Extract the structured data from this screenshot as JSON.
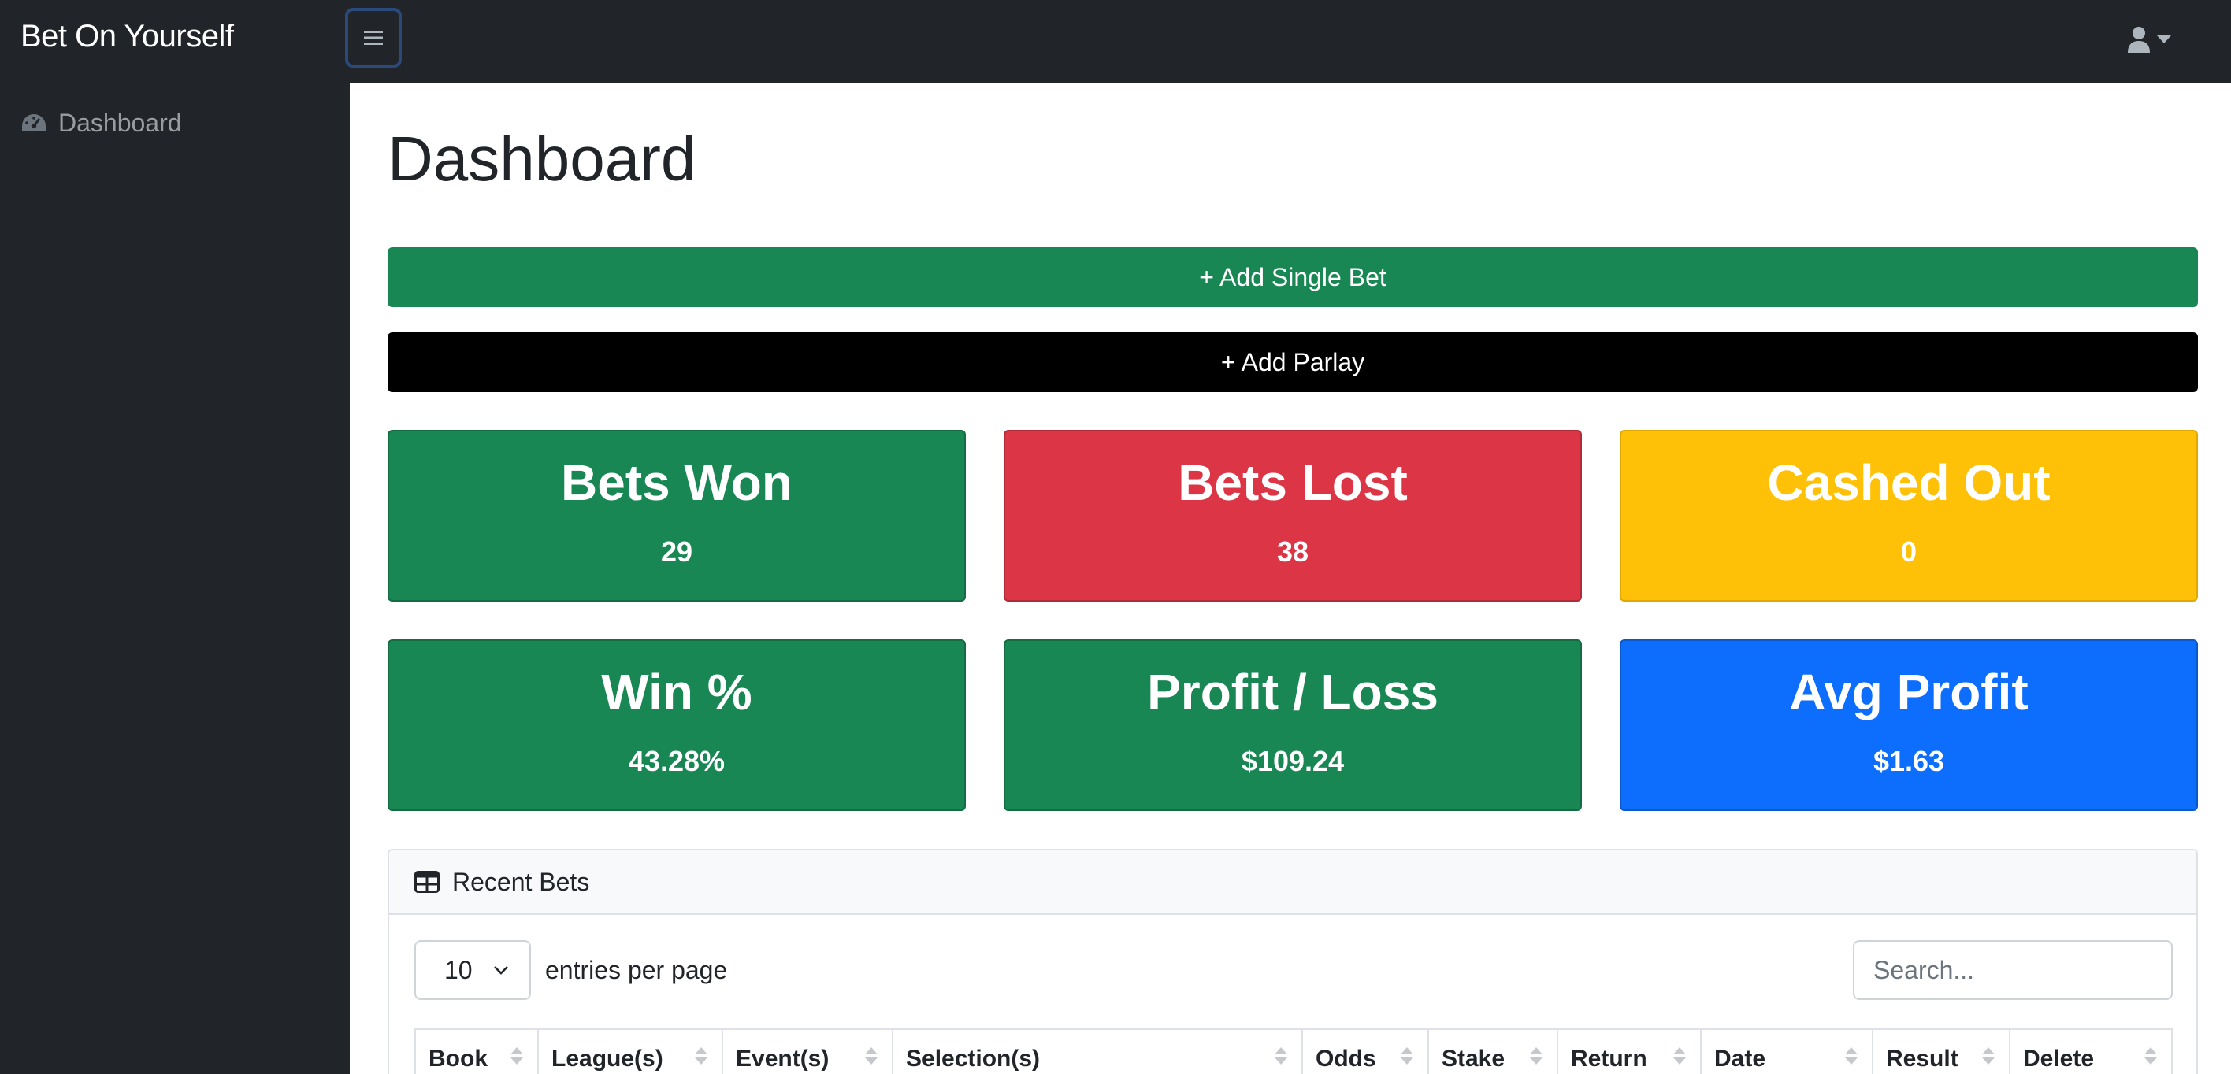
{
  "app": {
    "brand": "Bet On Yourself"
  },
  "sidebar": {
    "items": [
      {
        "label": "Dashboard",
        "icon": "tachometer-icon"
      }
    ]
  },
  "header": {
    "toggle_icon": "hamburger-icon",
    "user_icon": "user-icon"
  },
  "main": {
    "title": "Dashboard",
    "add_single_label": "+ Add Single Bet",
    "add_parlay_label": "+ Add Parlay"
  },
  "stats": [
    {
      "title": "Bets Won",
      "value": "29",
      "color": "#198754"
    },
    {
      "title": "Bets Lost",
      "value": "38",
      "color": "#dc3545"
    },
    {
      "title": "Cashed Out",
      "value": "0",
      "color": "#ffc107"
    },
    {
      "title": "Win %",
      "value": "43.28%",
      "color": "#198754"
    },
    {
      "title": "Profit / Loss",
      "value": "$109.24",
      "color": "#198754"
    },
    {
      "title": "Avg Profit",
      "value": "$1.63",
      "color": "#0d6efd"
    }
  ],
  "recent_bets": {
    "title": "Recent Bets",
    "icon": "table-icon",
    "entries_value": "10",
    "entries_label": "entries per page",
    "search_placeholder": "Search...",
    "columns": [
      "Book",
      "League(s)",
      "Event(s)",
      "Selection(s)",
      "Odds",
      "Stake",
      "Return",
      "Date",
      "Result",
      "Delete"
    ]
  }
}
